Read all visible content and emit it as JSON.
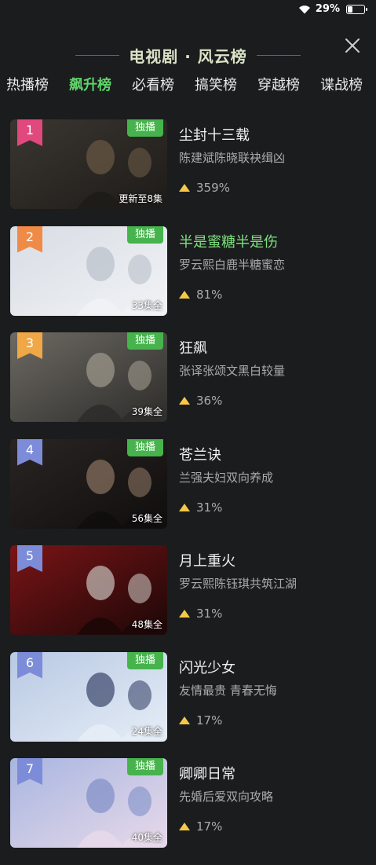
{
  "status": {
    "battery": "29%",
    "battery_level": 0.29
  },
  "header": {
    "title": "电视剧 · 风云榜"
  },
  "tabs": [
    {
      "label": "热播榜",
      "active": false
    },
    {
      "label": "飙升榜",
      "active": true
    },
    {
      "label": "必看榜",
      "active": false
    },
    {
      "label": "搞笑榜",
      "active": false
    },
    {
      "label": "穿越榜",
      "active": false
    },
    {
      "label": "谍战榜",
      "active": false
    }
  ],
  "items": [
    {
      "rank": "1",
      "rank_color": "#e0487e",
      "badge": "独播",
      "episodes": "更新至8集",
      "title": "尘封十三载",
      "desc": "陈建斌陈晓联袂缉凶",
      "trend": "359%",
      "highlight": false
    },
    {
      "rank": "2",
      "rank_color": "#f08a47",
      "badge": "独播",
      "episodes": "33集全",
      "title": "半是蜜糖半是伤",
      "desc": "罗云熙白鹿半糖蜜恋",
      "trend": "81%",
      "highlight": true
    },
    {
      "rank": "3",
      "rank_color": "#f0a745",
      "badge": "独播",
      "episodes": "39集全",
      "title": "狂飙",
      "desc": "张译张颂文黑白较量",
      "trend": "36%",
      "highlight": false
    },
    {
      "rank": "4",
      "rank_color": "#7d8cd8",
      "badge": "独播",
      "episodes": "56集全",
      "title": "苍兰诀",
      "desc": "兰强夫妇双向养成",
      "trend": "31%",
      "highlight": false
    },
    {
      "rank": "5",
      "rank_color": "#7d8cd8",
      "badge": "",
      "episodes": "48集全",
      "title": "月上重火",
      "desc": "罗云熙陈钰琪共筑江湖",
      "trend": "31%",
      "highlight": false
    },
    {
      "rank": "6",
      "rank_color": "#7d8cd8",
      "badge": "独播",
      "episodes": "24集全",
      "title": "闪光少女",
      "desc": "友情最贵 青春无悔",
      "trend": "17%",
      "highlight": false
    },
    {
      "rank": "7",
      "rank_color": "#7d8cd8",
      "badge": "独播",
      "episodes": "40集全",
      "title": "卿卿日常",
      "desc": "先婚后爱双向攻略",
      "trend": "17%",
      "highlight": false
    }
  ],
  "colors": {
    "accent": "#5fd36a",
    "badge": "#46b34c",
    "trend_icon": "#f5c84a"
  }
}
